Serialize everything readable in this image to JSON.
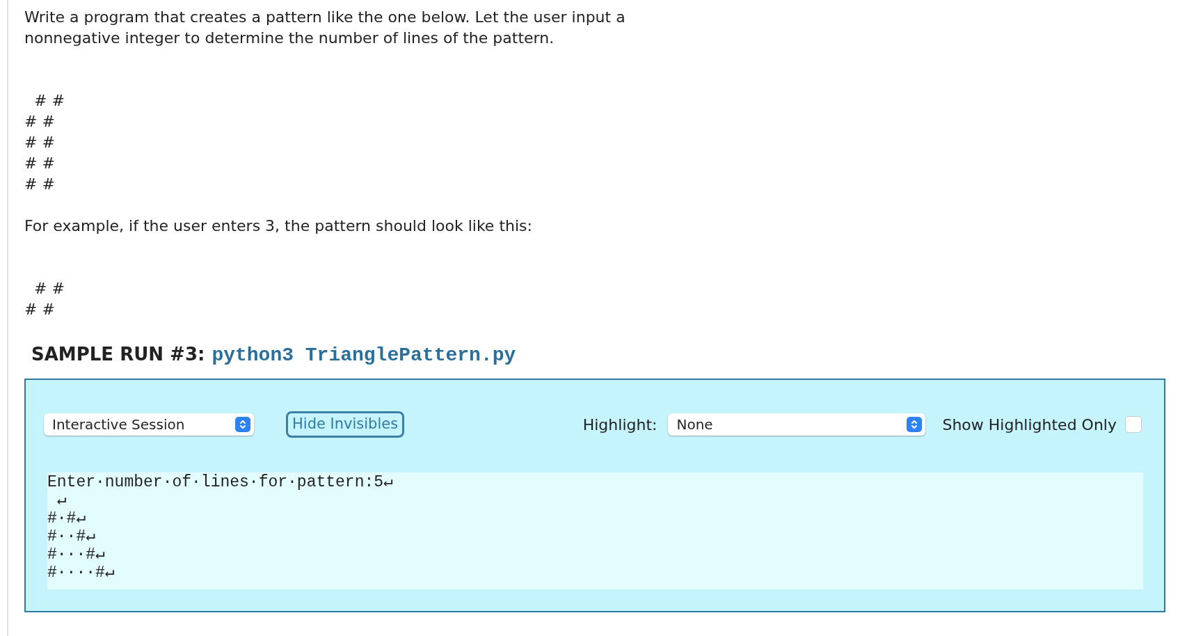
{
  "instructions": "Write a program that creates a pattern like the one below. Let the user input a nonnegative integer to determine the number of lines of the pattern.",
  "pattern_lines": [
    "  # #",
    "# #",
    "# #",
    "# #",
    "# #"
  ],
  "example_text": "For example, if the user enters 3, the pattern should look like this:",
  "example_lines": [
    "  # #",
    "# #"
  ],
  "sample_run": {
    "label": "SAMPLE RUN #3:",
    "command": "python3 TrianglePattern.py",
    "mode_select": {
      "value": "Interactive Session"
    },
    "toggle_button": {
      "label": "Hide Invisibles"
    },
    "highlight_label": "Highlight:",
    "highlight_select": {
      "value": "None"
    },
    "show_highlighted_only": {
      "label": "Show Highlighted Only",
      "checked": false
    },
    "console_lines": [
      "Enter·number·of·lines·for·pattern:5↵",
      " ↵",
      "#·#↵",
      "#··#↵",
      "#···#↵",
      "#····#↵"
    ]
  }
}
